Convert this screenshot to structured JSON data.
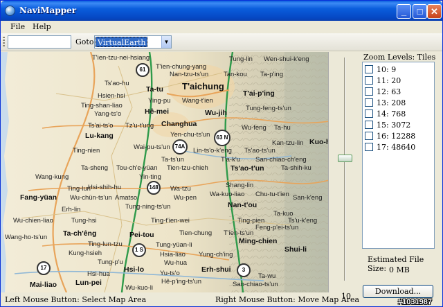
{
  "window": {
    "title": "NaviMapper",
    "minimize_icon": "minimize-icon",
    "maximize_icon": "maximize-icon",
    "close_icon": "close-icon"
  },
  "menu": {
    "file": "File",
    "help": "Help"
  },
  "toolbar": {
    "location_value": "",
    "goto_label": "Goto",
    "goto_selected": "VirtualEarth"
  },
  "map": {
    "labels": [
      {
        "text": "T'ien-tzu-nei-hsiang",
        "style": "normal"
      },
      {
        "text": "T'ien-chung-yang",
        "style": "normal"
      },
      {
        "text": "Tung-lin",
        "style": "normal"
      },
      {
        "text": "Wen-shui-k'eng",
        "style": "normal"
      },
      {
        "text": "Nan-tzu-ts'un",
        "style": "normal"
      },
      {
        "text": "Tan-kou",
        "style": "normal"
      },
      {
        "text": "Ta-p'ing",
        "style": "normal"
      },
      {
        "text": "Ts'ao-hu",
        "style": "normal"
      },
      {
        "text": "Ta-tu",
        "style": "bold"
      },
      {
        "text": "T'aichung",
        "style": "big"
      },
      {
        "text": "T'ai-p'ing",
        "style": "bold"
      },
      {
        "text": "Hsien-hsi",
        "style": "normal"
      },
      {
        "text": "Ying-pu",
        "style": "normal"
      },
      {
        "text": "Wang-t'ien",
        "style": "normal"
      },
      {
        "text": "Tung-feng-ts'un",
        "style": "normal"
      },
      {
        "text": "Ting-shan-liao",
        "style": "normal"
      },
      {
        "text": "Hê-mei",
        "style": "bold"
      },
      {
        "text": "Wu-jih",
        "style": "bold"
      },
      {
        "text": "Yang-ts'o",
        "style": "normal"
      },
      {
        "text": "Ts'ai-ts'o",
        "style": "normal"
      },
      {
        "text": "Tz'u-t'ung",
        "style": "normal"
      },
      {
        "text": "Changhua",
        "style": "bold"
      },
      {
        "text": "Wu-feng",
        "style": "normal"
      },
      {
        "text": "Ta-hu",
        "style": "normal"
      },
      {
        "text": "Lu-kang",
        "style": "bold"
      },
      {
        "text": "Yen-chu-ts'un",
        "style": "normal"
      },
      {
        "text": "Kan-tzu-lin",
        "style": "normal"
      },
      {
        "text": "Kuo-h",
        "style": "bold"
      },
      {
        "text": "Ting-nien",
        "style": "normal"
      },
      {
        "text": "Wai-pu-ts'un",
        "style": "normal"
      },
      {
        "text": "Lin-ts'o-k'eng",
        "style": "normal"
      },
      {
        "text": "Ts'ao-ts'un",
        "style": "normal"
      },
      {
        "text": "Ta-ts'un",
        "style": "normal"
      },
      {
        "text": "T'a-k'u",
        "style": "normal"
      },
      {
        "text": "San-chiao-ch'eng",
        "style": "normal"
      },
      {
        "text": "Ta-sheng",
        "style": "normal"
      },
      {
        "text": "Tou-ch'e-yüan",
        "style": "normal"
      },
      {
        "text": "Tien-tzu-chieh",
        "style": "normal"
      },
      {
        "text": "Ts'ao-t'un",
        "style": "bold"
      },
      {
        "text": "Ta-shih-ku",
        "style": "normal"
      },
      {
        "text": "Wang-kung",
        "style": "normal"
      },
      {
        "text": "Yin-ting",
        "style": "normal"
      },
      {
        "text": "Hsi-shih-hu",
        "style": "normal"
      },
      {
        "text": "Wa-tzu",
        "style": "normal"
      },
      {
        "text": "Shang-lin",
        "style": "normal"
      },
      {
        "text": "Ting-lun",
        "style": "normal"
      },
      {
        "text": "Wa-kuo-liao",
        "style": "normal"
      },
      {
        "text": "Chu-tu-t'ien",
        "style": "normal"
      },
      {
        "text": "Fang-yüan",
        "style": "bold"
      },
      {
        "text": "Wu-chün-ts'un",
        "style": "normal"
      },
      {
        "text": "Amatso",
        "style": "normal"
      },
      {
        "text": "Wu-pen",
        "style": "normal"
      },
      {
        "text": "San-k'eng",
        "style": "normal"
      },
      {
        "text": "Erh-lin",
        "style": "normal"
      },
      {
        "text": "Tung-ning-ts'un",
        "style": "normal"
      },
      {
        "text": "Nan-t'ou",
        "style": "bold"
      },
      {
        "text": "Wu-chien-liao",
        "style": "normal"
      },
      {
        "text": "Tung-hsi",
        "style": "normal"
      },
      {
        "text": "Ting-t'ien-wei",
        "style": "normal"
      },
      {
        "text": "Ting-pien",
        "style": "normal"
      },
      {
        "text": "Ta-kuo",
        "style": "normal"
      },
      {
        "text": "Ts'u-k'eng",
        "style": "normal"
      },
      {
        "text": "Ta-ch'êng",
        "style": "bold"
      },
      {
        "text": "Tien-chung",
        "style": "normal"
      },
      {
        "text": "T'ien-ts'un",
        "style": "normal"
      },
      {
        "text": "Feng-p'ei-ts'un",
        "style": "normal"
      },
      {
        "text": "Pei-tou",
        "style": "bold"
      },
      {
        "text": "Wang-ho-ts'un",
        "style": "normal"
      },
      {
        "text": "Ming-chien",
        "style": "bold"
      },
      {
        "text": "Ting-lun-tzu",
        "style": "normal"
      },
      {
        "text": "Kung-hsieh",
        "style": "normal"
      },
      {
        "text": "Tung-yüan-li",
        "style": "normal"
      },
      {
        "text": "Shui-li",
        "style": "bold"
      },
      {
        "text": "Hsia-liao",
        "style": "normal"
      },
      {
        "text": "Yung-ch'ing",
        "style": "normal"
      },
      {
        "text": "Tung-p'u",
        "style": "normal"
      },
      {
        "text": "Hsi-lo",
        "style": "bold"
      },
      {
        "text": "Wu-hua",
        "style": "normal"
      },
      {
        "text": "Erh-shui",
        "style": "bold"
      },
      {
        "text": "Hsi-hua",
        "style": "normal"
      },
      {
        "text": "Yu-ts'o",
        "style": "normal"
      },
      {
        "text": "Ta-wu",
        "style": "normal"
      },
      {
        "text": "Mai-liao",
        "style": "bold"
      },
      {
        "text": "Lun-pei",
        "style": "bold"
      },
      {
        "text": "San-chiao-ts'un",
        "style": "normal"
      },
      {
        "text": "Hê-p'ing-ts'un",
        "style": "normal"
      },
      {
        "text": "Wu-kuo-li",
        "style": "normal"
      }
    ],
    "shields": [
      "61",
      "63 N",
      "74A",
      "148",
      "1 S",
      "17",
      "3"
    ]
  },
  "slider": {
    "min_label": "10",
    "level": 0.45
  },
  "zoom_panel": {
    "title": "Zoom Levels: Tiles",
    "levels": [
      {
        "label": "10: 9",
        "checked": false
      },
      {
        "label": "11: 20",
        "checked": false
      },
      {
        "label": "12: 63",
        "checked": false
      },
      {
        "label": "13: 208",
        "checked": false
      },
      {
        "label": "14: 768",
        "checked": false
      },
      {
        "label": "15: 3072",
        "checked": false
      },
      {
        "label": "16: 12288",
        "checked": false
      },
      {
        "label": "17: 48640",
        "checked": false
      }
    ],
    "estimated_label": "Estimated File Size:",
    "estimated_value": "0 MB",
    "download_label": "Download..."
  },
  "status": {
    "left": "Left Mouse Button: Select Map Area",
    "right": "Right Mouse Button: Move Map Area"
  },
  "watermark": "#1031987"
}
